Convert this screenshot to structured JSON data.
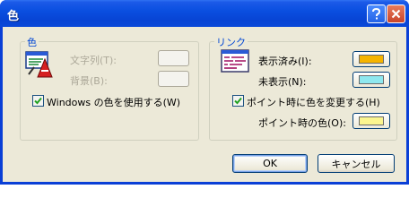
{
  "window": {
    "title": "色"
  },
  "color_group": {
    "title": "色",
    "text_label": "文字列(T):",
    "background_label": "背景(B):",
    "use_windows_colors_label": "Windows の色を使用する(W)",
    "use_windows_colors_checked": true
  },
  "link_group": {
    "title": "リンク",
    "visited_label": "表示済み(I):",
    "visited_color": "#f5b400",
    "unvisited_label": "未表示(N):",
    "unvisited_color": "#8ee8ef",
    "hover_enabled_label": "ポイント時に色を変更する(H)",
    "hover_enabled_checked": true,
    "hover_color_label": "ポイント時の色(O):",
    "hover_color": "#fbf58f"
  },
  "buttons": {
    "ok": "OK",
    "cancel": "キャンセル"
  },
  "icons": {
    "help": "help-icon",
    "close": "close-icon",
    "colors": "colors-palette-icon",
    "links": "links-page-icon"
  }
}
